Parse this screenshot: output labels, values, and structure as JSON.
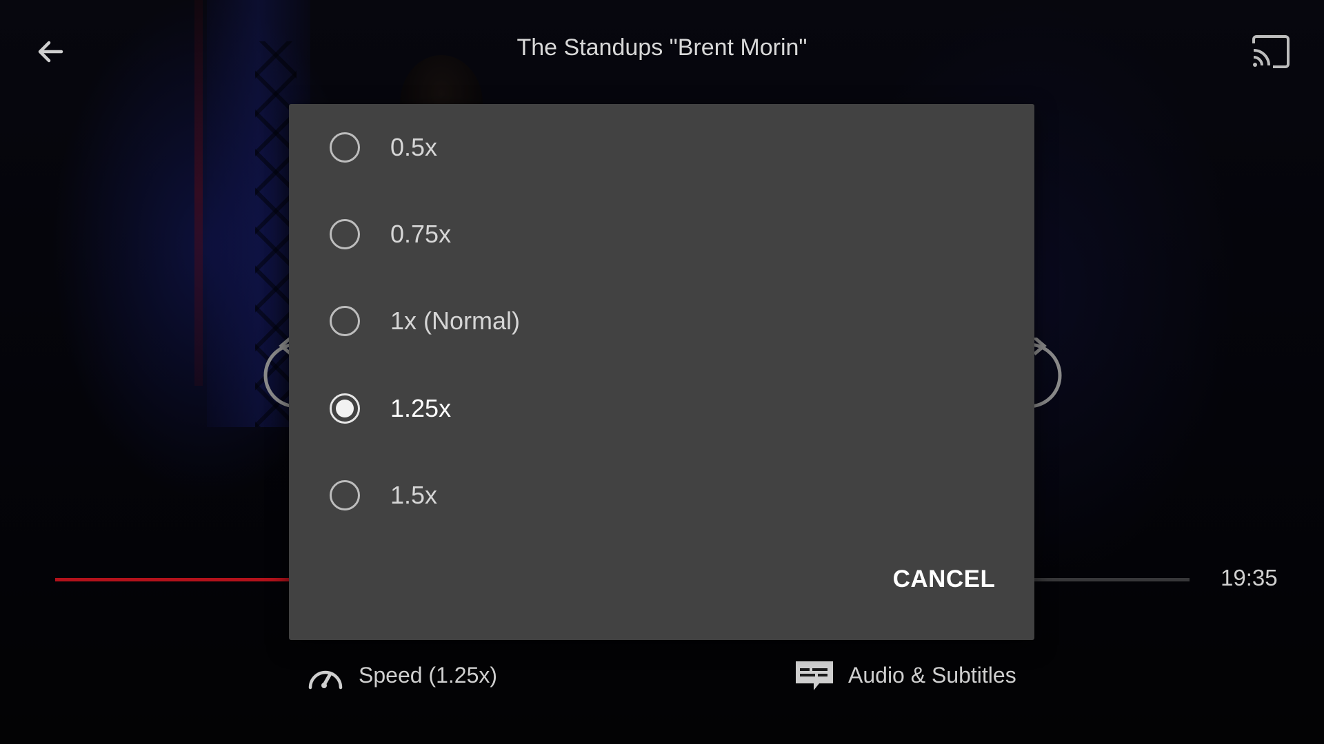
{
  "header": {
    "title": "The Standups  \"Brent Morin\"",
    "back_icon": "arrow-left-icon",
    "cast_icon": "cast-icon"
  },
  "playback": {
    "progress_percent": 22,
    "time_remaining": "19:35",
    "accent_color": "#b3121b"
  },
  "speed_dialog": {
    "options": [
      {
        "label": "0.5x",
        "selected": false
      },
      {
        "label": "0.75x",
        "selected": false
      },
      {
        "label": "1x (Normal)",
        "selected": false
      },
      {
        "label": "1.25x",
        "selected": true
      },
      {
        "label": "1.5x",
        "selected": false
      }
    ],
    "cancel_label": "CANCEL"
  },
  "bottom_controls": {
    "speed_label": "Speed (1.25x)",
    "speed_icon": "speedometer-icon",
    "audio_label": "Audio & Subtitles",
    "audio_icon": "subtitles-icon"
  }
}
